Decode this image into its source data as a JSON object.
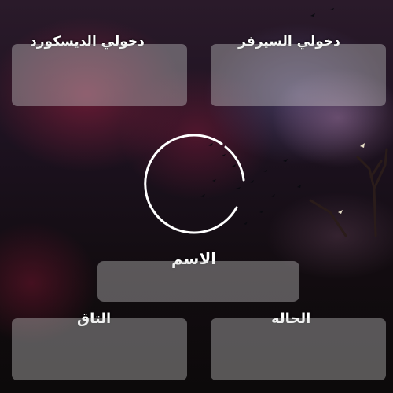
{
  "fields": {
    "discord_login": {
      "label": "دخولي الديسكورد"
    },
    "server_login": {
      "label": "دخولي السيرفر"
    },
    "name": {
      "label": "الاسم"
    },
    "tag": {
      "label": "التاق"
    },
    "status": {
      "label": "الحاله"
    }
  },
  "avatar": {
    "icon": "avatar-ring-icon",
    "color": "#ffffff"
  },
  "colors": {
    "field_bg": "#d2d2d2",
    "text": "#ffffff"
  }
}
